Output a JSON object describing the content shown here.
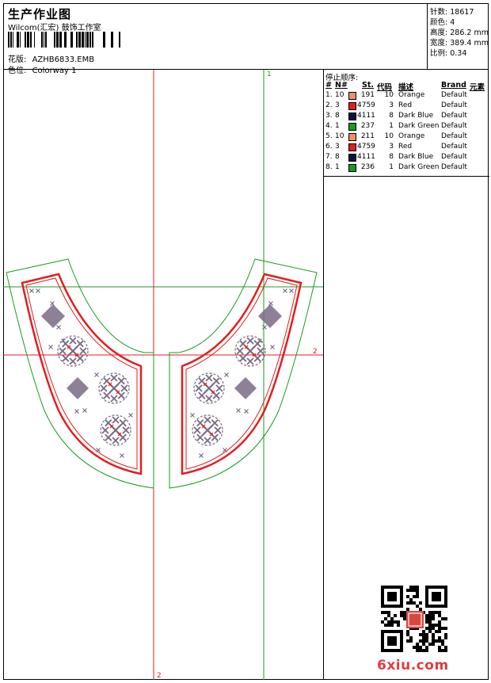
{
  "header": {
    "title": "生产作业图",
    "company": "Wilcom(汇宏) 鼓饰工作室",
    "design_label": "花版:",
    "design_value": "AZHB6833.EMB",
    "colorway_label": "色位:",
    "colorway_value": "Colorway 1"
  },
  "stats": [
    {
      "label": "针数:",
      "value": "18617"
    },
    {
      "label": "颜色:",
      "value": "4"
    },
    {
      "label": "高度:",
      "value": "286.2 mm"
    },
    {
      "label": "宽度:",
      "value": "389.4 mm"
    },
    {
      "label": "比例:",
      "value": "0.34"
    }
  ],
  "thread_panel": {
    "title": "停止顺序:",
    "headers": {
      "hash": "#",
      "num": "N#",
      "st": "St.",
      "code": "代码",
      "desc": "描述",
      "brand": "Brand",
      "elem": "元素"
    },
    "rows": [
      {
        "idx": "1.",
        "n": "10",
        "color": "#e8926a",
        "st": "191",
        "code": "10",
        "desc": "Orange",
        "brand": "Default"
      },
      {
        "idx": "2.",
        "n": "3",
        "color": "#e01f1f",
        "st": "4759",
        "code": "3",
        "desc": "Red",
        "brand": "Default"
      },
      {
        "idx": "3.",
        "n": "8",
        "color": "#0c1240",
        "st": "4111",
        "code": "8",
        "desc": "Dark Blue",
        "brand": "Default"
      },
      {
        "idx": "4.",
        "n": "1",
        "color": "#1c9a26",
        "st": "237",
        "code": "1",
        "desc": "Dark Green",
        "brand": "Default"
      },
      {
        "idx": "5.",
        "n": "10",
        "color": "#e8926a",
        "st": "211",
        "code": "10",
        "desc": "Orange",
        "brand": "Default"
      },
      {
        "idx": "6.",
        "n": "3",
        "color": "#e01f1f",
        "st": "4759",
        "code": "3",
        "desc": "Red",
        "brand": "Default"
      },
      {
        "idx": "7.",
        "n": "8",
        "color": "#0c1240",
        "st": "4111",
        "code": "8",
        "desc": "Dark Blue",
        "brand": "Default"
      },
      {
        "idx": "8.",
        "n": "1",
        "color": "#1c9a26",
        "st": "236",
        "code": "1",
        "desc": "Dark Green",
        "brand": "Default"
      }
    ]
  },
  "canvas": {
    "guide_labels": {
      "green_top": "1",
      "red_right": "2",
      "red_bottom": "2"
    },
    "colors": {
      "red": "#e01f1f",
      "green": "#1c9a26",
      "motif": "#7a6a84"
    }
  },
  "watermark": {
    "site": "6xiu.com"
  }
}
